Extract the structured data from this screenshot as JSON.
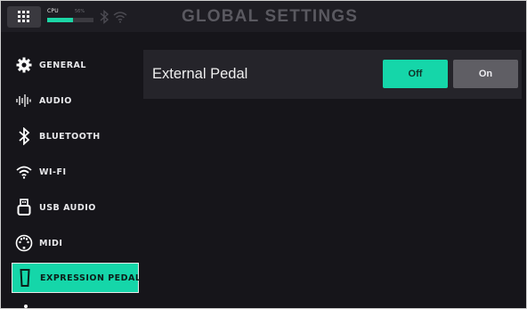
{
  "header": {
    "title": "GLOBAL SETTINGS",
    "cpu_label": "CPU",
    "cpu_percent_text": "56%",
    "cpu_load": 0.56,
    "icons": [
      "menu-icon",
      "bluetooth-icon",
      "wifi-icon"
    ]
  },
  "sidebar": {
    "items": [
      {
        "label": "GENERAL",
        "icon": "gear-icon",
        "active": false
      },
      {
        "label": "AUDIO",
        "icon": "audio-waveform-icon",
        "active": false
      },
      {
        "label": "BLUETOOTH",
        "icon": "bluetooth-icon",
        "active": false
      },
      {
        "label": "WI-FI",
        "icon": "wifi-icon",
        "active": false
      },
      {
        "label": "USB AUDIO",
        "icon": "usb-icon",
        "active": false
      },
      {
        "label": "MIDI",
        "icon": "midi-icon",
        "active": false
      },
      {
        "label": "EXPRESSION PEDAL",
        "icon": "pedal-icon",
        "active": true
      }
    ]
  },
  "main": {
    "setting": {
      "label": "External Pedal",
      "options": [
        "Off",
        "On"
      ],
      "selected": "Off"
    }
  },
  "colors": {
    "accent": "#15d6a9",
    "background": "#16151a",
    "panel": "#25242a",
    "inactive_button": "#5f5e64"
  }
}
